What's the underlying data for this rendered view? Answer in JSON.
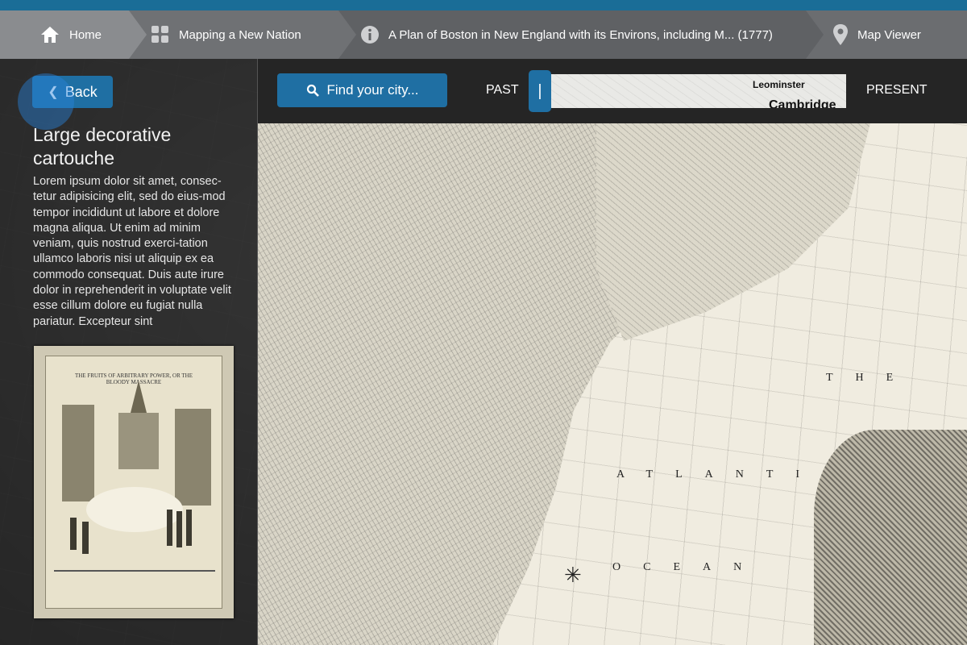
{
  "breadcrumb": {
    "home": {
      "label": "Home",
      "icon": "home-icon"
    },
    "collection": {
      "label": "Mapping a New Nation",
      "icon": "grid-icon"
    },
    "item": {
      "label": "A Plan of Boston in New England with its Environs, including M... (1777)",
      "icon": "info-icon"
    },
    "viewer": {
      "label": "Map Viewer",
      "icon": "map-pin-icon"
    }
  },
  "panel": {
    "back_label": "Back",
    "title": "Large decorative cartouche",
    "body": "Lorem ipsum dolor sit amet, consec-tetur adipisicing elit, sed do eius-mod tempor incididunt ut labore et dolore magna aliqua. Ut enim ad minim veniam, quis nostrud exerci-tation ullamco laboris nisi ut aliquip ex ea commodo consequat. Duis aute irure dolor in reprehenderit in voluptate velit esse cillum dolore eu fugiat nulla pariatur. Excepteur sint",
    "image_caption": "THE FRUITS OF ARBITRARY POWER, OR THE BLOODY MASSACRE"
  },
  "map_controls": {
    "search_label": "Find your city...",
    "past_label": "PAST",
    "present_label": "PRESENT",
    "preview_places": [
      "Leominster",
      "Cambridge"
    ],
    "handle_glyph": "|"
  },
  "map_labels": {
    "sea_1": "THE",
    "sea_2": "ATLANTIC",
    "sea_3": "OCEAN"
  },
  "colors": {
    "accent": "#1f6fa3",
    "topstrip": "#1a6d97"
  }
}
